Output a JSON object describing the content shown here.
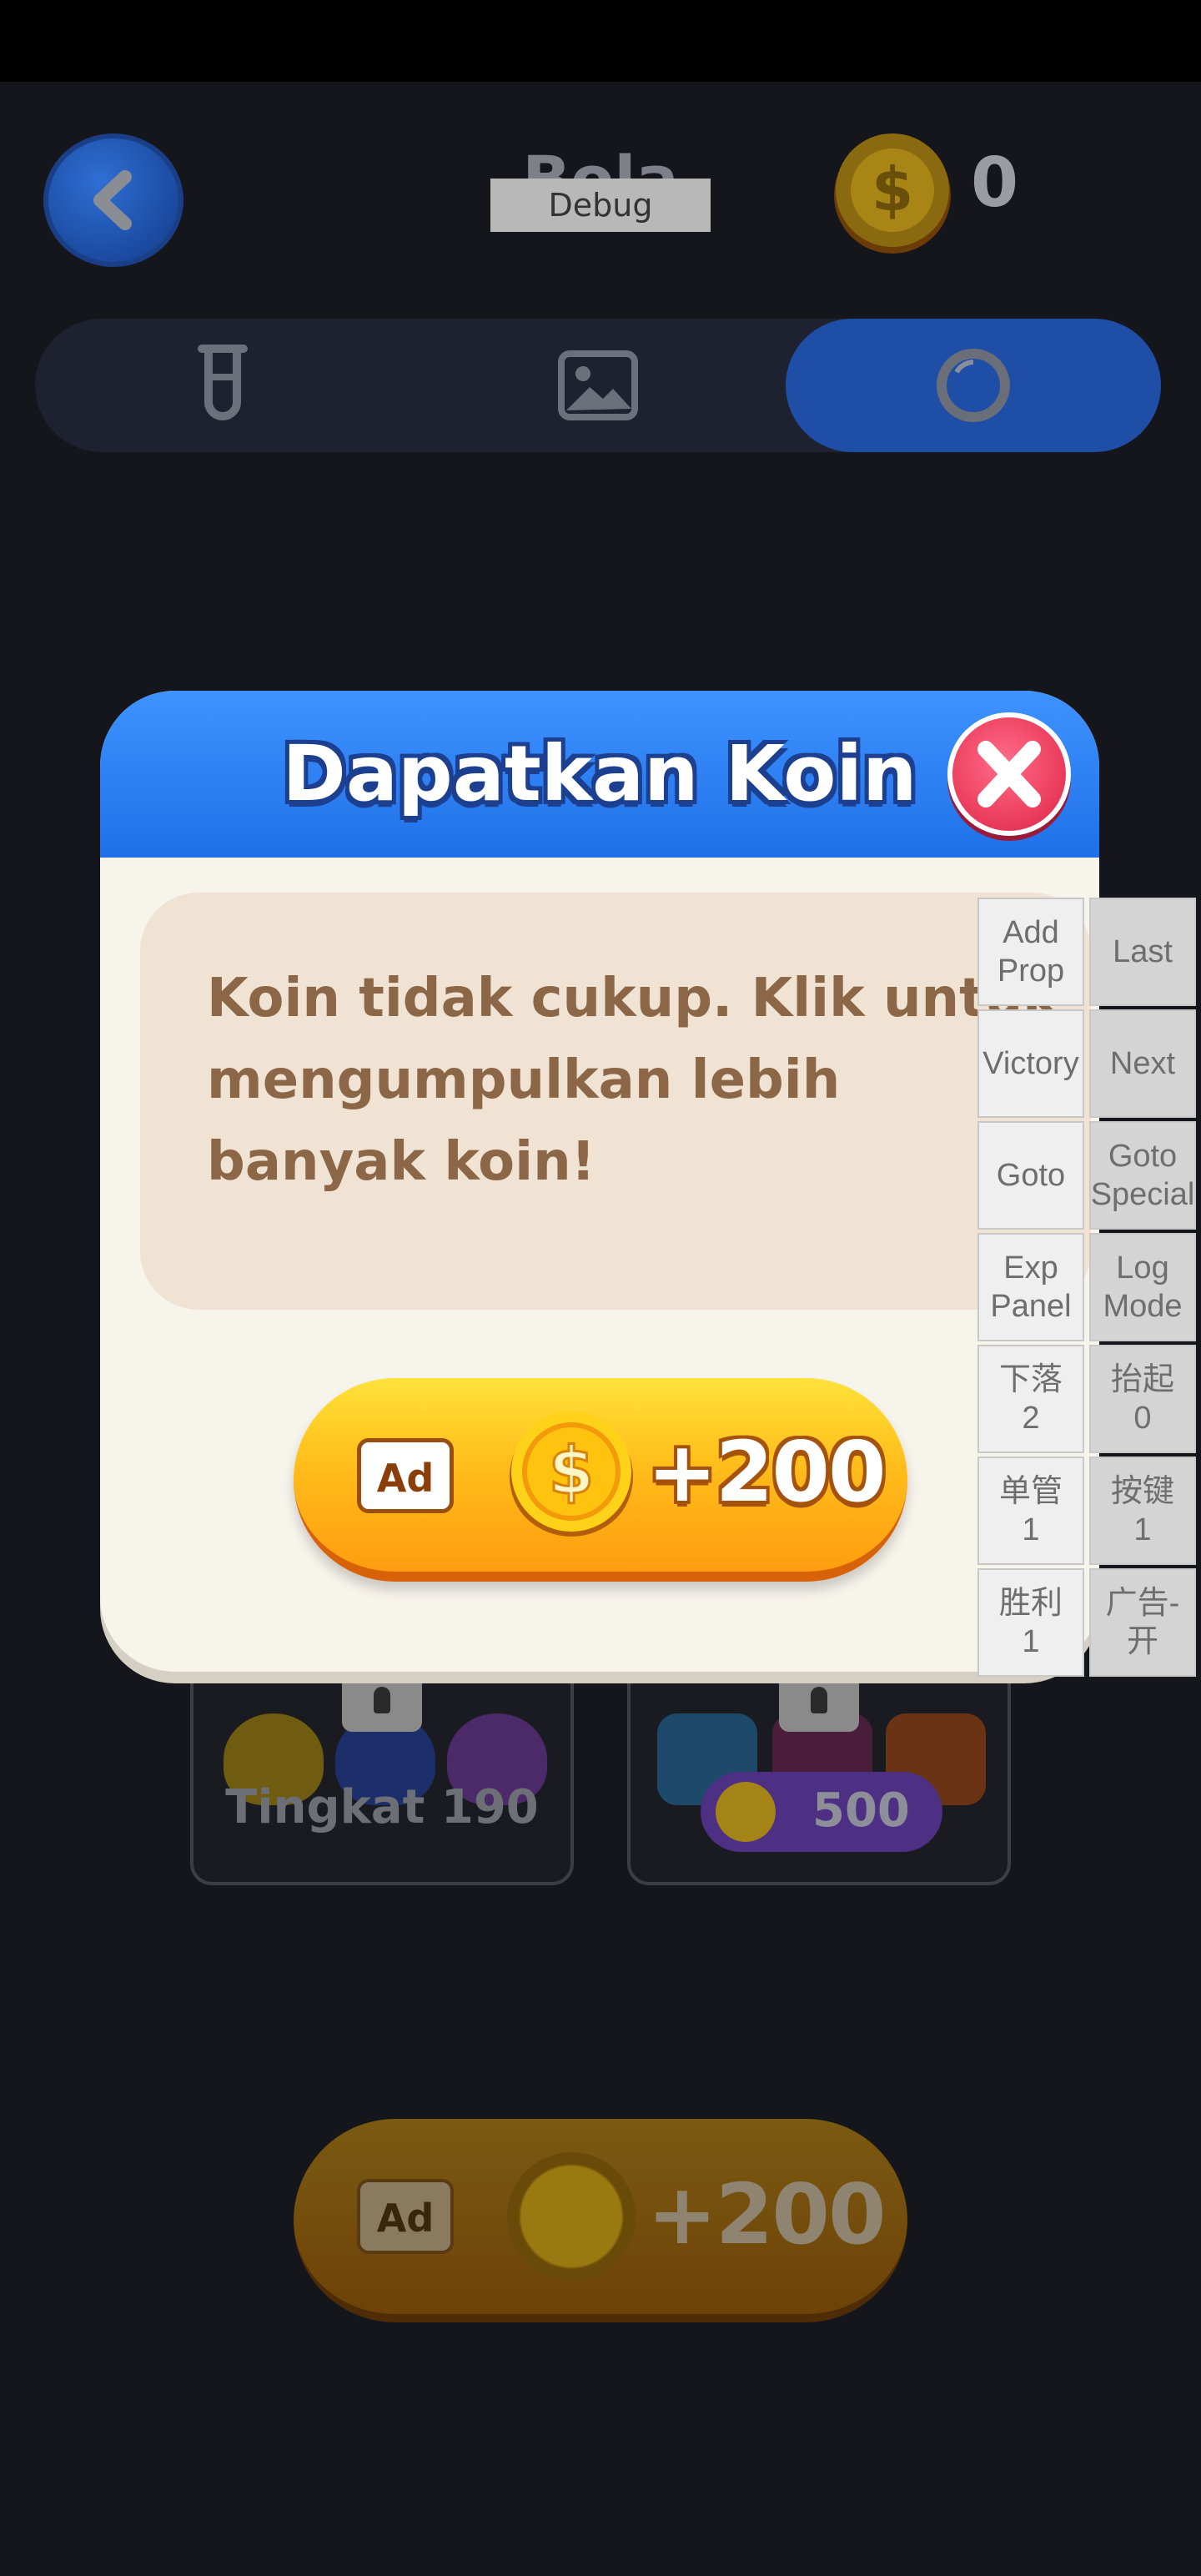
{
  "header": {
    "title": "Bola",
    "debug_label": "Debug",
    "coin_count": "0"
  },
  "tabs": [
    {
      "name": "tube",
      "icon": "test-tube-icon"
    },
    {
      "name": "image",
      "icon": "image-icon"
    },
    {
      "name": "ball",
      "icon": "ring-icon",
      "selected": true
    }
  ],
  "cards": [
    {
      "label": "Tingkat 190",
      "locked": true
    },
    {
      "price": "500",
      "locked": true
    }
  ],
  "bottom_ad": {
    "tag": "Ad",
    "amount": "+200"
  },
  "dialog": {
    "title": "Dapatkan Koin",
    "message": "Koin tidak cukup. Klik untuk mengumpulkan lebih banyak koin!",
    "ad_button": {
      "tag": "Ad",
      "amount": "+200"
    }
  },
  "debug_panel": {
    "buttons": [
      [
        "Add\nProp",
        "Last"
      ],
      [
        "Victory",
        "Next"
      ],
      [
        "Goto",
        "Goto\nSpecial"
      ],
      [
        "Exp\nPanel",
        "Log\nMode"
      ],
      [
        "下落\n2",
        "抬起\n0"
      ],
      [
        "单管\n1",
        "按键\n1"
      ],
      [
        "胜利\n1",
        "广告-开"
      ]
    ]
  },
  "colors": {
    "dialog_header": "#2f82f5",
    "ad_button": "#ffb01c",
    "close_button": "#ea3e5f",
    "message_text": "#8b6748"
  }
}
